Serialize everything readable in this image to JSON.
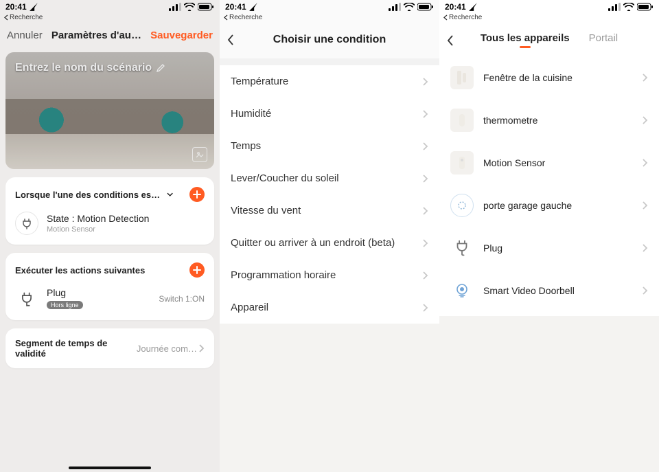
{
  "status": {
    "time": "20:41",
    "breadcrumb": "Recherche"
  },
  "screen1": {
    "header": {
      "cancel": "Annuler",
      "title": "Paramètres d'au…",
      "save": "Sauvegarder"
    },
    "hero_title": "Entrez le nom du scénario",
    "conditions": {
      "header": "Lorsque l'une des conditions est re…",
      "item": {
        "title": "State : Motion Detection",
        "subtitle": "Motion Sensor"
      }
    },
    "actions": {
      "header": "Exécuter les actions suivantes",
      "item": {
        "title": "Plug",
        "badge": "Hors ligne",
        "right": "Switch 1:ON"
      }
    },
    "segment": {
      "label": "Segment de temps de validité",
      "value": "Journée com…"
    }
  },
  "screen2": {
    "title": "Choisir une condition",
    "rows": [
      "Température",
      "Humidité",
      "Temps",
      "Lever/Coucher du soleil",
      "Vitesse du vent",
      "Quitter ou arriver à un endroit (beta)",
      "Programmation horaire",
      "Appareil"
    ]
  },
  "screen3": {
    "tabs": {
      "active": "Tous les appareils",
      "inactive": "Portail"
    },
    "devices": [
      {
        "name": "Fenêtre de la cuisine",
        "icon": "window-sensor"
      },
      {
        "name": "thermometre",
        "icon": "thermo"
      },
      {
        "name": "Motion Sensor",
        "icon": "motion"
      },
      {
        "name": "porte garage gauche",
        "icon": "circle"
      },
      {
        "name": "Plug",
        "icon": "plug"
      },
      {
        "name": "Smart Video Doorbell",
        "icon": "doorbell"
      }
    ]
  }
}
